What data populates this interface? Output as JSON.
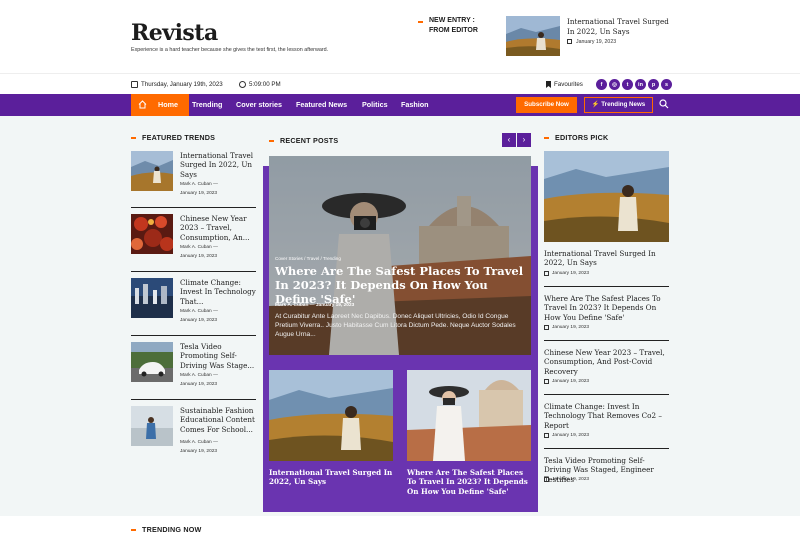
{
  "site": {
    "logo": "Revista",
    "tagline": "Experience is a hard teacher because she gives the test first, the lesson afterward."
  },
  "new_entry": {
    "label_line1": "NEW ENTRY :",
    "label_line2": "FROM EDITOR",
    "title": "International Travel Surged In 2022, Un Says",
    "date": "January 19, 2023"
  },
  "infobar": {
    "date": "Thursday, January 19th, 2023",
    "time": "5:09:00 PM",
    "favourites": "Favourites",
    "social_icons": [
      "facebook-icon",
      "instagram-icon",
      "twitter-icon",
      "linkedin-icon",
      "pinterest-icon",
      "skype-icon"
    ]
  },
  "nav": {
    "items": [
      "Home",
      "Trending",
      "Cover stories",
      "Featured News",
      "Politics",
      "Fashion"
    ],
    "subscribe": "Subscribe Now",
    "trending_news": "Trending News"
  },
  "featured_trends": {
    "heading": "FEATURED TRENDS",
    "items": [
      {
        "title": "International Travel Surged In 2022, Un Says",
        "author": "Mark A. Cuban",
        "date": "January 19, 2023"
      },
      {
        "title": "Chinese New Year 2023 – Travel, Consumption, An...",
        "author": "Mark A. Cuban",
        "date": "January 19, 2023"
      },
      {
        "title": "Climate Change: Invest In Technology That...",
        "author": "Mark A. Cuban",
        "date": "January 19, 2023"
      },
      {
        "title": "Tesla Video Promoting Self-Driving Was Stage...",
        "author": "Mark A. Cuban",
        "date": "January 19, 2023"
      },
      {
        "title": "Sustainable Fashion Educational Content Comes For School...",
        "author": "Mark A. Cuban",
        "date": "January 19, 2023"
      }
    ]
  },
  "recent_posts": {
    "heading": "RECENT POSTS",
    "hero": {
      "categories": "Cover Stories / Travel / Trending",
      "title": "Where Are The Safest Places To Travel In 2023? It Depends On How You Define 'Safe'",
      "author": "Mark A. Cuban",
      "date": "January 19, 2023",
      "excerpt": "At Curabitur Ante Laoreet Nec Dapibus. Donec Aliquet Ultricies, Odio Id Congue Pretium Viverra.. Justo Habitasse Cum Litora Dictum Pede. Neque Auctor Sodales Augue Urna..."
    },
    "cards": [
      {
        "title": "International Travel Surged In 2022, Un Says"
      },
      {
        "title": "Where Are The Safest Places To Travel In 2023? It Depends On How You Define 'Safe'"
      }
    ]
  },
  "editors_pick": {
    "heading": "EDITORS PICK",
    "items": [
      {
        "title": "International Travel Surged In 2022, Un Says",
        "date": "January 19, 2023"
      },
      {
        "title": "Where Are The Safest Places To Travel In 2023? It Depends On How You Define 'Safe'",
        "date": "January 19, 2023"
      },
      {
        "title": "Chinese New Year 2023 – Travel, Consumption, And Post-Covid Recovery",
        "date": "January 19, 2023"
      },
      {
        "title": "Climate Change: Invest In Technology That Removes Co2 – Report",
        "date": "January 19, 2023"
      },
      {
        "title": "Tesla Video Promoting Self-Driving Was Staged, Engineer Testifies",
        "date": "January 19, 2023"
      }
    ]
  },
  "trending_now": {
    "heading": "TRENDING NOW"
  },
  "colors": {
    "brand_purple": "#5b1f9b",
    "panel_purple": "#6a34b0",
    "accent_orange": "#ff6a00"
  }
}
